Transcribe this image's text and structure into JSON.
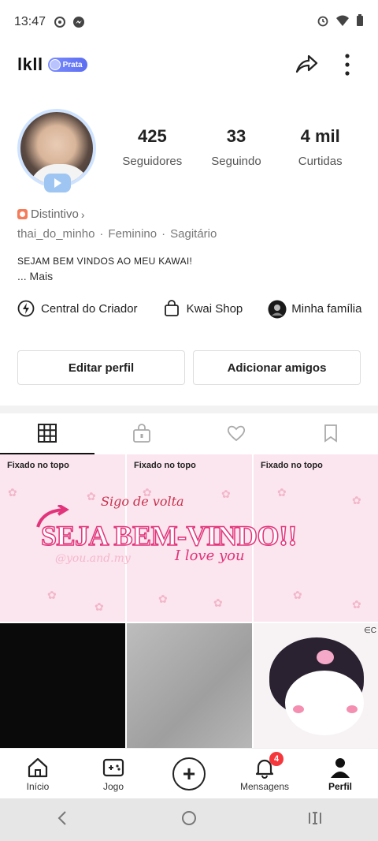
{
  "status_bar": {
    "time": "13:47"
  },
  "header": {
    "username": "lkll",
    "level_badge": "Prata"
  },
  "profile": {
    "stats": [
      {
        "value": "425",
        "label": "Seguidores"
      },
      {
        "value": "33",
        "label": "Seguindo"
      },
      {
        "value": "4 mil",
        "label": "Curtidas"
      }
    ],
    "distintivo": "Distintivo",
    "handle": "thai_do_minho",
    "gender": "Feminino",
    "sign": "Sagitário",
    "bio": "SEJAM BEM VINDOS AO MEU KAWAI!",
    "bio_more": "...  Mais"
  },
  "links": [
    {
      "label": "Central do Criador",
      "icon": "lightning-icon"
    },
    {
      "label": "Kwai Shop",
      "icon": "shopping-bag-icon"
    },
    {
      "label": "Minha família",
      "icon": "family-avatar-icon"
    }
  ],
  "buttons": {
    "edit": "Editar perfil",
    "add_friends": "Adicionar amigos"
  },
  "tabs": [
    "grid-icon",
    "lock-icon",
    "heart-icon",
    "bookmark-icon"
  ],
  "grid": {
    "pinned_label": "Fixado no topo",
    "banner": {
      "sigo": "Sigo de volta",
      "main": "SEJA BEM-VINDO!!",
      "handle": "@you.and.my",
      "love": "I love you"
    }
  },
  "bottom_nav": [
    {
      "label": "Início",
      "icon": "home-icon"
    },
    {
      "label": "Jogo",
      "icon": "gamepad-icon"
    },
    {
      "label": "",
      "icon": "plus-icon"
    },
    {
      "label": "Mensagens",
      "icon": "bell-icon",
      "badge": "4"
    },
    {
      "label": "Perfil",
      "icon": "person-icon"
    }
  ]
}
